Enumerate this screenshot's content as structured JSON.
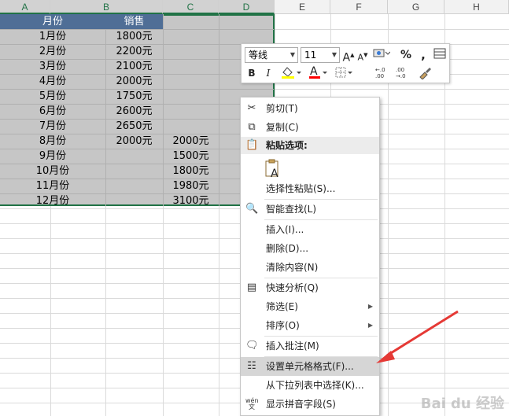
{
  "columns": [
    "A",
    "B",
    "C",
    "D",
    "E",
    "F",
    "G",
    "H"
  ],
  "header_row": [
    "月份",
    "销售"
  ],
  "rows": [
    {
      "a": "1月份",
      "b": "1800元",
      "c": ""
    },
    {
      "a": "2月份",
      "b": "2200元",
      "c": ""
    },
    {
      "a": "3月份",
      "b": "2100元",
      "c": ""
    },
    {
      "a": "4月份",
      "b": "2000元",
      "c": ""
    },
    {
      "a": "5月份",
      "b": "1750元",
      "c": ""
    },
    {
      "a": "6月份",
      "b": "2600元",
      "c": ""
    },
    {
      "a": "7月份",
      "b": "2650元",
      "c": ""
    },
    {
      "a": "8月份",
      "b": "2000元",
      "c": "2000元"
    },
    {
      "a": "9月份",
      "b": "",
      "c": "1500元"
    },
    {
      "a": "10月份",
      "b": "",
      "c": "1800元"
    },
    {
      "a": "11月份",
      "b": "",
      "c": "1980元"
    },
    {
      "a": "12月份",
      "b": "",
      "c": "3100元"
    }
  ],
  "mini_toolbar": {
    "font_name": "等线",
    "font_size": "11",
    "grow_font": "A",
    "shrink_font": "A",
    "percent": "%",
    "comma": ",",
    "bold": "B",
    "italic": "I",
    "font_color_letter": "A",
    "fill_color": "#ffff00",
    "font_color": "#ff0000"
  },
  "context_menu": {
    "cut": "剪切(T)",
    "copy": "复制(C)",
    "paste_options": "粘贴选项:",
    "paste_special": "选择性粘贴(S)...",
    "smart_lookup": "智能查找(L)",
    "insert": "插入(I)...",
    "delete": "删除(D)...",
    "clear_contents": "清除内容(N)",
    "quick_analysis": "快速分析(Q)",
    "filter": "筛选(E)",
    "sort": "排序(O)",
    "insert_comment": "插入批注(M)",
    "format_cells": "设置单元格格式(F)...",
    "pick_from_list": "从下拉列表中选择(K)...",
    "show_phonetic": "显示拼音字段(S)"
  },
  "accent_color": "#217346",
  "header_fill": "#4f6e96",
  "arrow_color": "#e53935",
  "watermark": "Bai du 经验"
}
